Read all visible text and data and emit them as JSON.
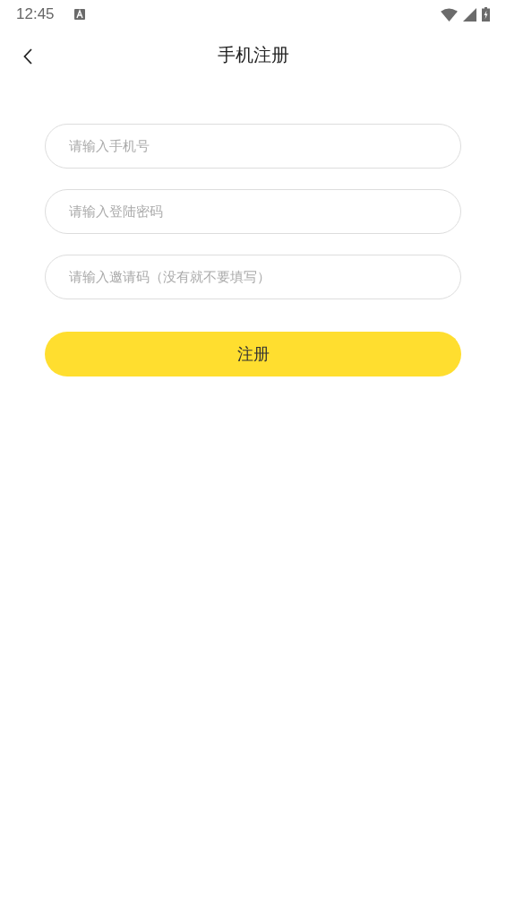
{
  "status_bar": {
    "time": "12:45"
  },
  "header": {
    "title": "手机注册"
  },
  "fields": [
    {
      "placeholder": "请输入手机号"
    },
    {
      "placeholder": "请输入登陆密码"
    },
    {
      "placeholder": "请输入邀请码（没有就不要填写）"
    }
  ],
  "submit_button": {
    "label": "注册"
  }
}
